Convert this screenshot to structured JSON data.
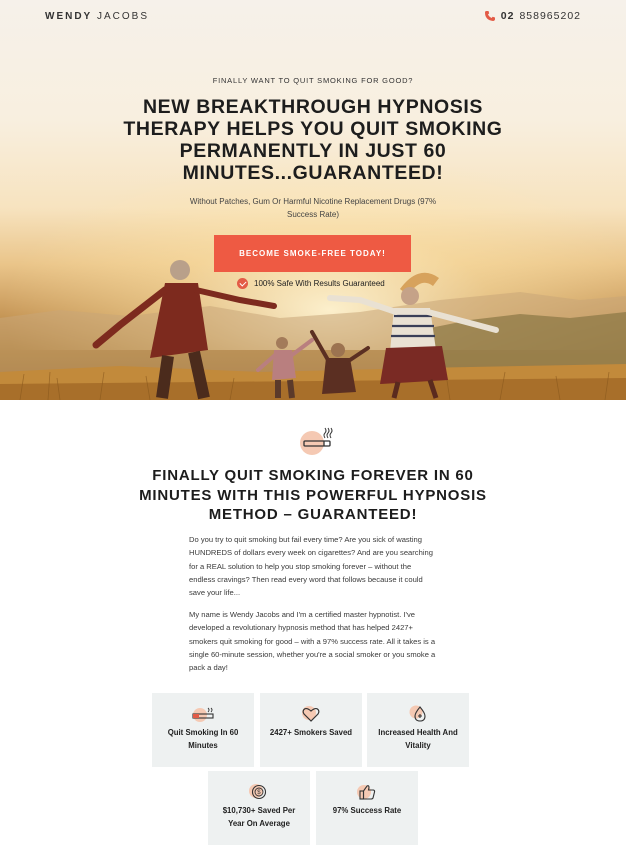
{
  "header": {
    "logo_first": "WENDY",
    "logo_last": "JACOBS",
    "phone_prefix": "02",
    "phone_number": "858965202"
  },
  "hero": {
    "eyebrow": "FINALLY WANT TO QUIT SMOKING FOR GOOD?",
    "headline": "NEW BREAKTHROUGH HYPNOSIS THERAPY HELPS YOU QUIT SMOKING PERMANENTLY IN JUST 60 MINUTES...GUARANTEED!",
    "subhead": "Without Patches, Gum Or Harmful Nicotine Replacement Drugs (97% Success Rate)",
    "cta_label": "BECOME SMOKE-FREE TODAY!",
    "guarantee": "100% Safe With Results Guaranteed"
  },
  "section": {
    "title": "FINALLY QUIT SMOKING FOREVER IN 60 MINUTES WITH THIS POWERFUL HYPNOSIS METHOD – GUARANTEED!",
    "para1": "Do you try to quit smoking but fail every time? Are you sick of wasting HUNDREDS of dollars every week on cigarettes? And are you searching for a REAL solution to help you stop smoking forever – without the endless cravings? Then read every word that follows because it could save your life...",
    "para2": "My name is Wendy Jacobs and I'm a certified master hypnotist. I've developed a revolutionary hypnosis method that has helped 2427+ smokers quit smoking for good – with a 97% success rate. All it takes is a single 60-minute session, whether you're a social smoker or you smoke a pack a day!"
  },
  "features": [
    {
      "icon": "cigarette-icon",
      "label": "Quit Smoking In 60 Minutes"
    },
    {
      "icon": "heart-icon",
      "label": "2427+ Smokers Saved"
    },
    {
      "icon": "health-drop-icon",
      "label": "Increased Health And Vitality"
    },
    {
      "icon": "money-icon",
      "label": "$10,730+ Saved Per Year On Average"
    },
    {
      "icon": "thumbs-up-icon",
      "label": "97% Success Rate"
    }
  ],
  "colors": {
    "accent": "#ee5a43",
    "card_bg": "#eef1f1",
    "icon_circle": "#f5c9b3"
  }
}
